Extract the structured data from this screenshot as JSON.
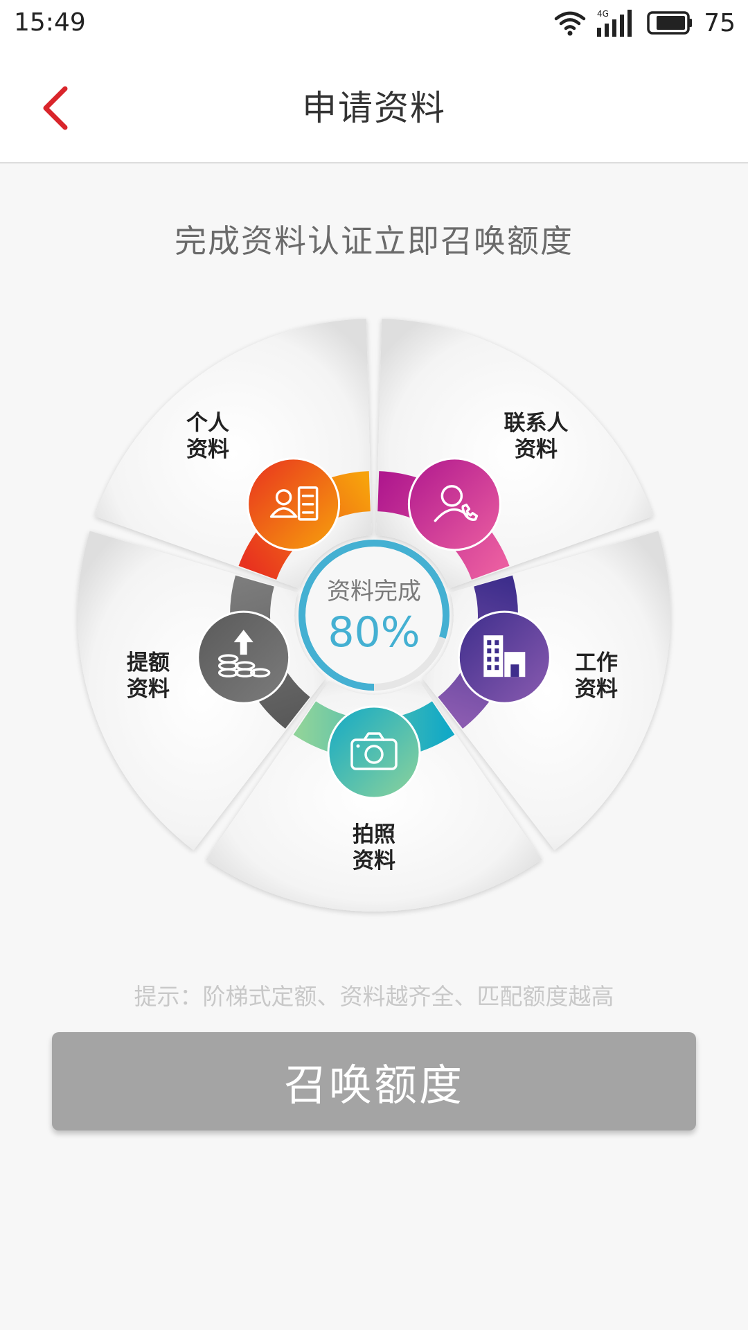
{
  "status_bar": {
    "time": "15:49",
    "network": "4G",
    "battery": "75",
    "icons": [
      "wifi-icon",
      "signal-icon",
      "battery-icon"
    ]
  },
  "nav": {
    "title": "申请资料",
    "back_icon": "chevron-left-icon",
    "back_color": "#d9252b"
  },
  "subtitle": "完成资料认证立即召唤额度",
  "progress": {
    "label": "资料完成",
    "value_text": "80%",
    "fraction": 0.8,
    "color": "#44b0d2"
  },
  "segments": [
    {
      "id": "personal",
      "line1": "个人",
      "line2": "资料",
      "icon": "id-card-icon",
      "colors": [
        "#e8321f",
        "#f7a20c"
      ]
    },
    {
      "id": "contacts",
      "line1": "联系人",
      "line2": "资料",
      "icon": "contact-phone-icon",
      "colors": [
        "#b0198e",
        "#ea5da0"
      ]
    },
    {
      "id": "work",
      "line1": "工作",
      "line2": "资料",
      "icon": "building-icon",
      "colors": [
        "#3e2e8c",
        "#8a5bb0"
      ]
    },
    {
      "id": "photo",
      "line1": "拍照",
      "line2": "资料",
      "icon": "camera-icon",
      "colors": [
        "#12a9c6",
        "#8fd39a"
      ]
    },
    {
      "id": "credit",
      "line1": "提额",
      "line2": "资料",
      "icon": "coins-upload-icon",
      "colors": [
        "#5a5a5a",
        "#7c7c7c"
      ]
    }
  ],
  "hint": "提示：阶梯式定额、资料越齐全、匹配额度越高",
  "button": {
    "label": "召唤额度",
    "color": "#a4a4a4"
  }
}
